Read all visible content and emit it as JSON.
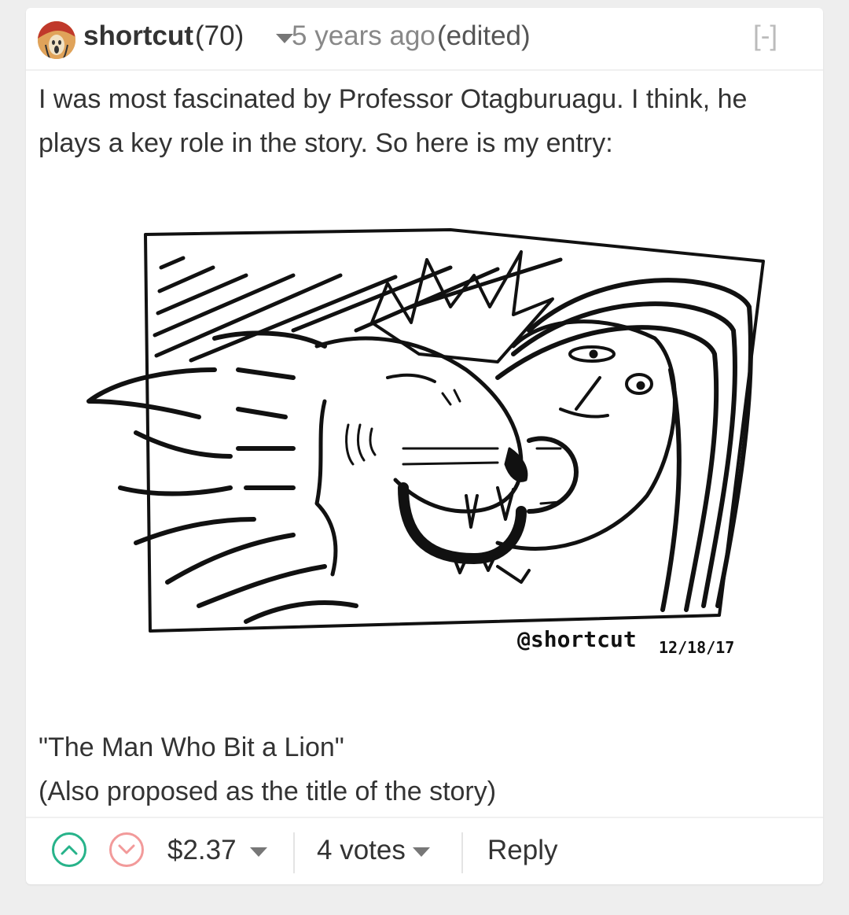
{
  "comment": {
    "author": "shortcut",
    "reputation": "(70)",
    "time": "5 years ago",
    "edited": "(edited)",
    "collapse": "[-]",
    "text": "I was most fascinated by Professor Otagburuagu. I think, he plays a key role in the story. So here is my entry:",
    "image": {
      "signature": "@shortcut",
      "date": "12/18/17"
    },
    "caption_line1": "\"The Man Who Bit a Lion\"",
    "caption_line2": "(Also proposed as the title of the story)"
  },
  "footer": {
    "upvote_icon": "chevron-up-circle",
    "downvote_icon": "chevron-down-circle",
    "payout": "$2.37",
    "votes": "4 votes",
    "reply": "Reply",
    "colors": {
      "upvote": "#27b38a",
      "downvote": "#f29a9a"
    }
  }
}
